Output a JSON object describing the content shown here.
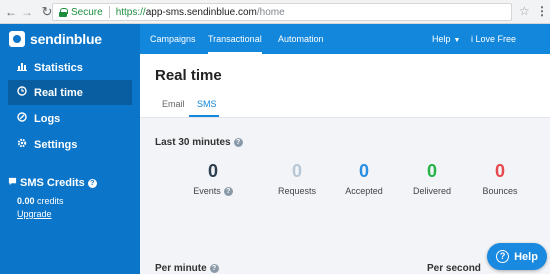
{
  "browser": {
    "secure_label": "Secure",
    "url_scheme": "https://",
    "url_host": "app-sms.sendinblue.com",
    "url_path": "/home"
  },
  "sidebar": {
    "brand": "sendinblue",
    "items": [
      {
        "label": "Statistics",
        "icon": "bar-chart-icon"
      },
      {
        "label": "Real time",
        "icon": "clock-icon"
      },
      {
        "label": "Logs",
        "icon": "logs-icon"
      },
      {
        "label": "Settings",
        "icon": "gear-icon"
      }
    ],
    "credits_title": "SMS Credits",
    "credits_value": "0.00",
    "credits_unit": " credits",
    "upgrade_label": "Upgrade"
  },
  "topnav": {
    "items": [
      "Campaigns",
      "Transactional",
      "Automation"
    ],
    "help_label": "Help",
    "account_label": "i Love Free Software"
  },
  "main": {
    "title": "Real time",
    "tabs": [
      "Email",
      "SMS"
    ],
    "last30_label": "Last 30 minutes",
    "stats": [
      {
        "value": "0",
        "label": "Events",
        "color": "#2d3e50"
      },
      {
        "value": "0",
        "label": "Requests",
        "color": "#b7c7d6"
      },
      {
        "value": "0",
        "label": "Accepted",
        "color": "#2a8fe0"
      },
      {
        "value": "0",
        "label": "Delivered",
        "color": "#25b34a"
      },
      {
        "value": "0",
        "label": "Bounces",
        "color": "#e5484d"
      }
    ],
    "per_minute_label": "Per minute",
    "per_second_label": "Per second"
  },
  "help_button": "Help",
  "colors": {
    "sidebar": "#0b75c9",
    "topnav": "#1287dc",
    "accent": "#1287dc"
  }
}
